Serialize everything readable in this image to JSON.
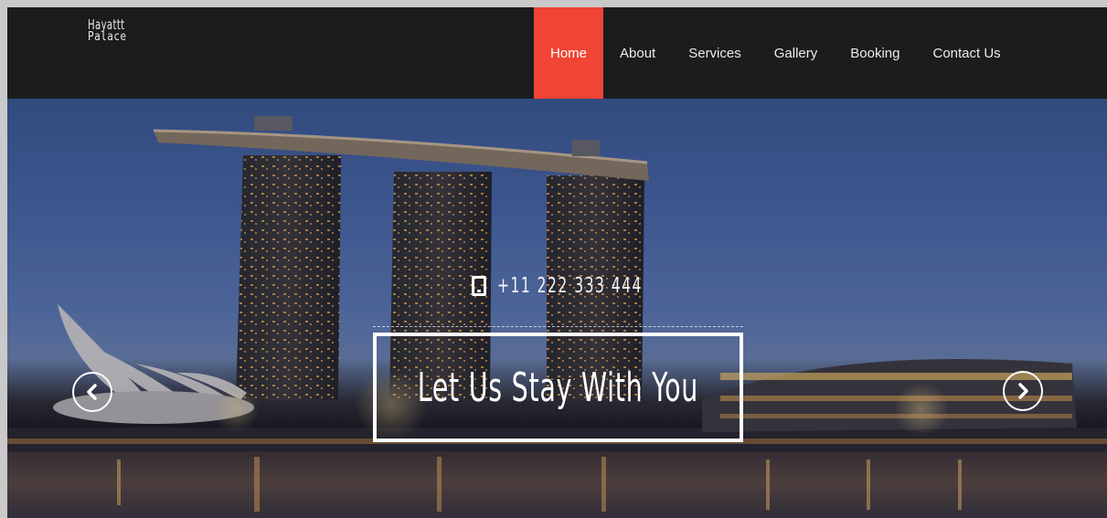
{
  "brand": {
    "line1": "Hayattt",
    "line2": "Palace"
  },
  "nav": {
    "items": [
      {
        "label": "Home",
        "active": true
      },
      {
        "label": "About",
        "active": false
      },
      {
        "label": "Services",
        "active": false
      },
      {
        "label": "Gallery",
        "active": false
      },
      {
        "label": "Booking",
        "active": false
      },
      {
        "label": "Contact Us",
        "active": false
      }
    ]
  },
  "hero": {
    "phone": "+11 222 333 444",
    "tagline": "Let Us Stay With You",
    "prev_icon": "chevron-left-icon",
    "next_icon": "chevron-right-icon"
  },
  "colors": {
    "accent": "#f04434",
    "navbar": "#1b1c1e"
  }
}
